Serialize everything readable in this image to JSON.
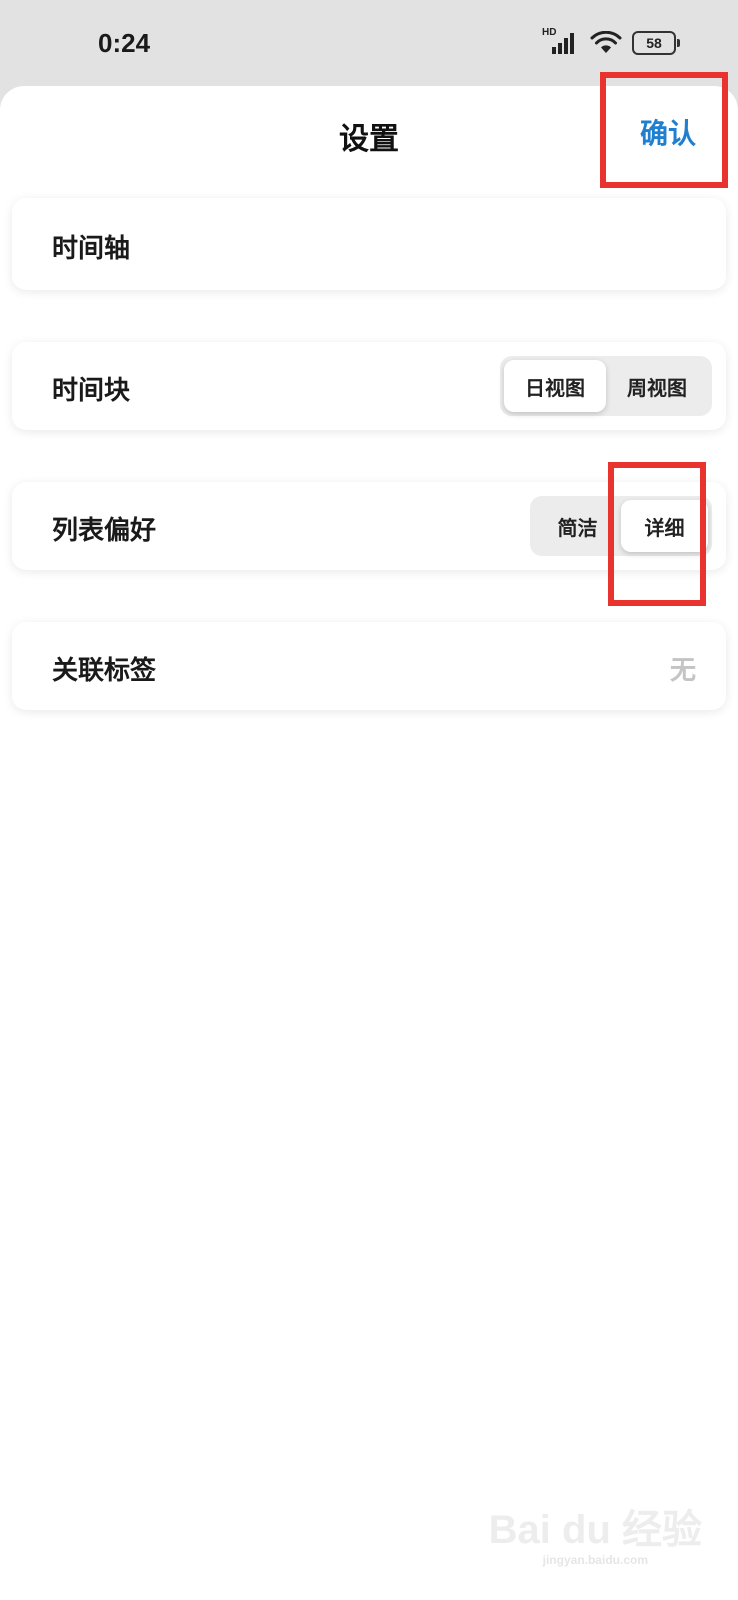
{
  "status_bar": {
    "time": "0:24",
    "network_label": "HD",
    "battery_level": "58",
    "icons": [
      "signal-icon",
      "wifi-icon",
      "battery-icon"
    ]
  },
  "sheet": {
    "title": "设置",
    "confirm_label": "确认"
  },
  "settings": {
    "timeline": {
      "label": "时间轴"
    },
    "time_block": {
      "label": "时间块",
      "options": [
        "日视图",
        "周视图"
      ],
      "selected": "日视图"
    },
    "list_pref": {
      "label": "列表偏好",
      "options": [
        "简洁",
        "详细"
      ],
      "selected": "详细"
    },
    "tags": {
      "label": "关联标签",
      "value": "无"
    }
  },
  "watermark": {
    "brand": "Bai du 经验",
    "url": "jingyan.baidu.com"
  },
  "colors": {
    "accent": "#1f7fd0",
    "highlight": "#e8332f",
    "background": "#e2e2e2",
    "muted": "#c4c4c4"
  }
}
